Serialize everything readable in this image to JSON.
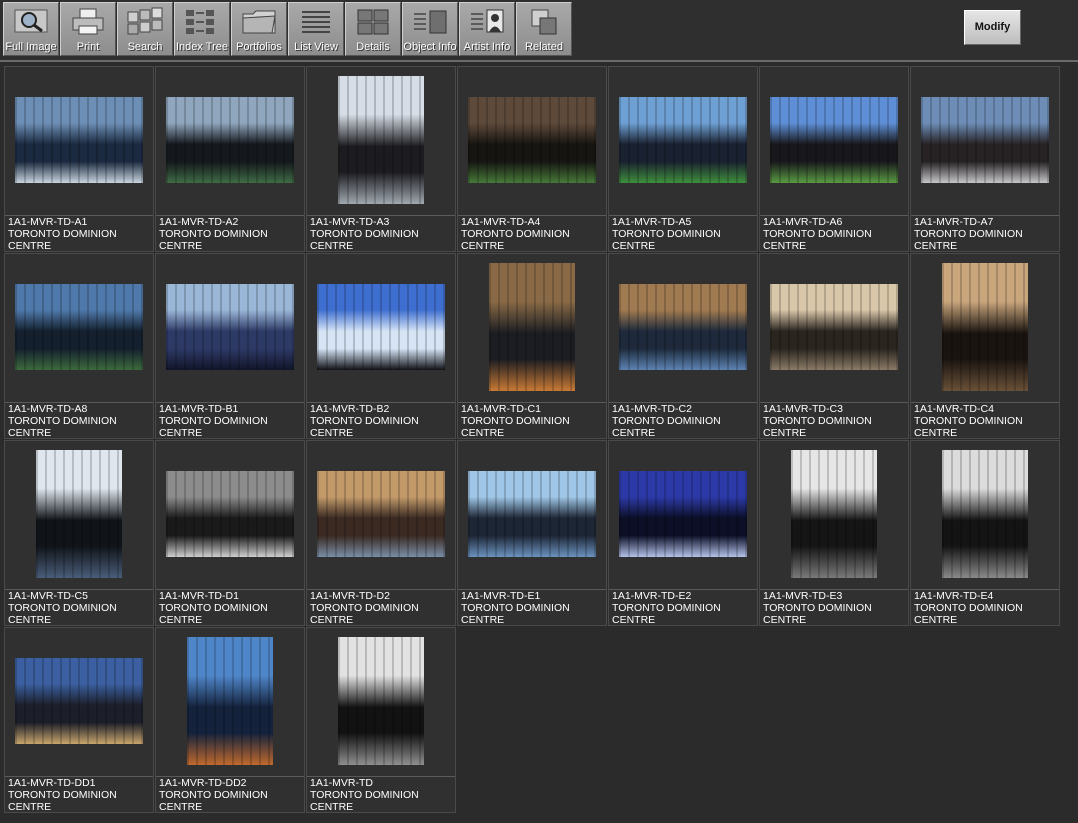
{
  "toolbar": {
    "buttons": [
      {
        "label": "Full Image",
        "icon": "magnifier-icon"
      },
      {
        "label": "Print",
        "icon": "printer-icon"
      },
      {
        "label": "Search",
        "icon": "search-grid-icon"
      },
      {
        "label": "Index Tree",
        "icon": "index-tree-icon"
      },
      {
        "label": "Portfolios",
        "icon": "folder-icon"
      },
      {
        "label": "List View",
        "icon": "list-view-icon"
      },
      {
        "label": "Details",
        "icon": "details-grid-icon"
      },
      {
        "label": "Object Info",
        "icon": "object-info-icon"
      },
      {
        "label": "Artist  Info",
        "icon": "artist-portrait-icon"
      },
      {
        "label": "Related",
        "icon": "related-squares-icon"
      }
    ],
    "modify_label": "Modify"
  },
  "items": [
    {
      "id": "1A1-MVR-TD-A1",
      "title1": "TORONTO DOMINION",
      "title2": "CENTRE",
      "colors": [
        "#6d8fb6",
        "#1b2a40",
        "#c9d5de"
      ],
      "orient": "landscape"
    },
    {
      "id": "1A1-MVR-TD-A2",
      "title1": "TORONTO DOMINION",
      "title2": "CENTRE",
      "colors": [
        "#8fa6be",
        "#15181d",
        "#3f6b45"
      ],
      "orient": "landscape"
    },
    {
      "id": "1A1-MVR-TD-A3",
      "title1": "TORONTO DOMINION",
      "title2": "CENTRE",
      "colors": [
        "#d6dde6",
        "#1c1c20",
        "#a0a8b0"
      ],
      "orient": "portrait"
    },
    {
      "id": "1A1-MVR-TD-A4",
      "title1": "TORONTO DOMINION",
      "title2": "CENTRE",
      "colors": [
        "#5e4a3a",
        "#171512",
        "#477a3a"
      ],
      "orient": "landscape"
    },
    {
      "id": "1A1-MVR-TD-A5",
      "title1": "TORONTO DOMINION",
      "title2": "CENTRE",
      "colors": [
        "#6fa0d4",
        "#1a2130",
        "#3f8f3c"
      ],
      "orient": "landscape"
    },
    {
      "id": "1A1-MVR-TD-A6",
      "title1": "TORONTO DOMINION",
      "title2": "CENTRE",
      "colors": [
        "#5e8fd6",
        "#18181c",
        "#5a9a42"
      ],
      "orient": "landscape"
    },
    {
      "id": "1A1-MVR-TD-A7",
      "title1": "TORONTO DOMINION",
      "title2": "CENTRE",
      "colors": [
        "#6d8db7",
        "#272325",
        "#c6c6c8"
      ],
      "orient": "landscape"
    },
    {
      "id": "1A1-MVR-TD-A8",
      "title1": "TORONTO DOMINION",
      "title2": "CENTRE",
      "colors": [
        "#4f79aa",
        "#14202e",
        "#3c6a3c"
      ],
      "orient": "landscape"
    },
    {
      "id": "1A1-MVR-TD-B1",
      "title1": "TORONTO DOMINION",
      "title2": "CENTRE",
      "colors": [
        "#9bb7d8",
        "#2e3a66",
        "#101528"
      ],
      "orient": "landscape"
    },
    {
      "id": "1A1-MVR-TD-B2",
      "title1": "TORONTO DOMINION",
      "title2": "CENTRE",
      "colors": [
        "#3e6fd0",
        "#d6e4f6",
        "#111317"
      ],
      "orient": "landscape"
    },
    {
      "id": "1A1-MVR-TD-C1",
      "title1": "TORONTO DOMINION",
      "title2": "CENTRE",
      "colors": [
        "#8a6a46",
        "#1b1d22",
        "#c87a35"
      ],
      "orient": "portrait"
    },
    {
      "id": "1A1-MVR-TD-C2",
      "title1": "TORONTO DOMINION",
      "title2": "CENTRE",
      "colors": [
        "#a07a50",
        "#1e2a3c",
        "#5c83b2"
      ],
      "orient": "landscape"
    },
    {
      "id": "1A1-MVR-TD-C3",
      "title1": "TORONTO DOMINION",
      "title2": "CENTRE",
      "colors": [
        "#d9c7a9",
        "#2a251f",
        "#8a7a66"
      ],
      "orient": "landscape"
    },
    {
      "id": "1A1-MVR-TD-C4",
      "title1": "TORONTO DOMINION",
      "title2": "CENTRE",
      "colors": [
        "#c9a67c",
        "#1a1410",
        "#6a5138"
      ],
      "orient": "portrait"
    },
    {
      "id": "1A1-MVR-TD-C5",
      "title1": "TORONTO DOMINION",
      "title2": "CENTRE",
      "colors": [
        "#dfe6ee",
        "#101418",
        "#4a5d7a"
      ],
      "orient": "portrait"
    },
    {
      "id": "1A1-MVR-TD-D1",
      "title1": "TORONTO DOMINION",
      "title2": "CENTRE",
      "colors": [
        "#8c8c8c",
        "#1a1a1a",
        "#cfcfcf"
      ],
      "orient": "landscape"
    },
    {
      "id": "1A1-MVR-TD-D2",
      "title1": "TORONTO DOMINION",
      "title2": "CENTRE",
      "colors": [
        "#c29a6a",
        "#3a2a22",
        "#7a8ea6"
      ],
      "orient": "landscape"
    },
    {
      "id": "1A1-MVR-TD-E1",
      "title1": "TORONTO DOMINION",
      "title2": "CENTRE",
      "colors": [
        "#9fc6e6",
        "#1d2635",
        "#6b93c0"
      ],
      "orient": "landscape"
    },
    {
      "id": "1A1-MVR-TD-E2",
      "title1": "TORONTO DOMINION",
      "title2": "CENTRE",
      "colors": [
        "#2c3aa8",
        "#0c0f26",
        "#b4c2ea"
      ],
      "orient": "landscape"
    },
    {
      "id": "1A1-MVR-TD-E3",
      "title1": "TORONTO DOMINION",
      "title2": "CENTRE",
      "colors": [
        "#e6e6e6",
        "#151515",
        "#7a7a7a"
      ],
      "orient": "portrait"
    },
    {
      "id": "1A1-MVR-TD-E4",
      "title1": "TORONTO DOMINION",
      "title2": "CENTRE",
      "colors": [
        "#dcdcdc",
        "#141414",
        "#8a8a8a"
      ],
      "orient": "portrait"
    },
    {
      "id": "1A1-MVR-TD-DD1",
      "title1": "TORONTO DOMINION",
      "title2": "CENTRE",
      "colors": [
        "#3b5fa0",
        "#1c1f2a",
        "#c8a56c"
      ],
      "orient": "landscape"
    },
    {
      "id": "1A1-MVR-TD-DD2",
      "title1": "TORONTO DOMINION",
      "title2": "CENTRE",
      "colors": [
        "#4f86c9",
        "#14223c",
        "#c06a2e"
      ],
      "orient": "portrait"
    },
    {
      "id": "1A1-MVR-TD",
      "title1": "TORONTO DOMINION",
      "title2": "CENTRE",
      "colors": [
        "#e2e2e2",
        "#121212",
        "#8f8f8f"
      ],
      "orient": "portrait"
    }
  ]
}
